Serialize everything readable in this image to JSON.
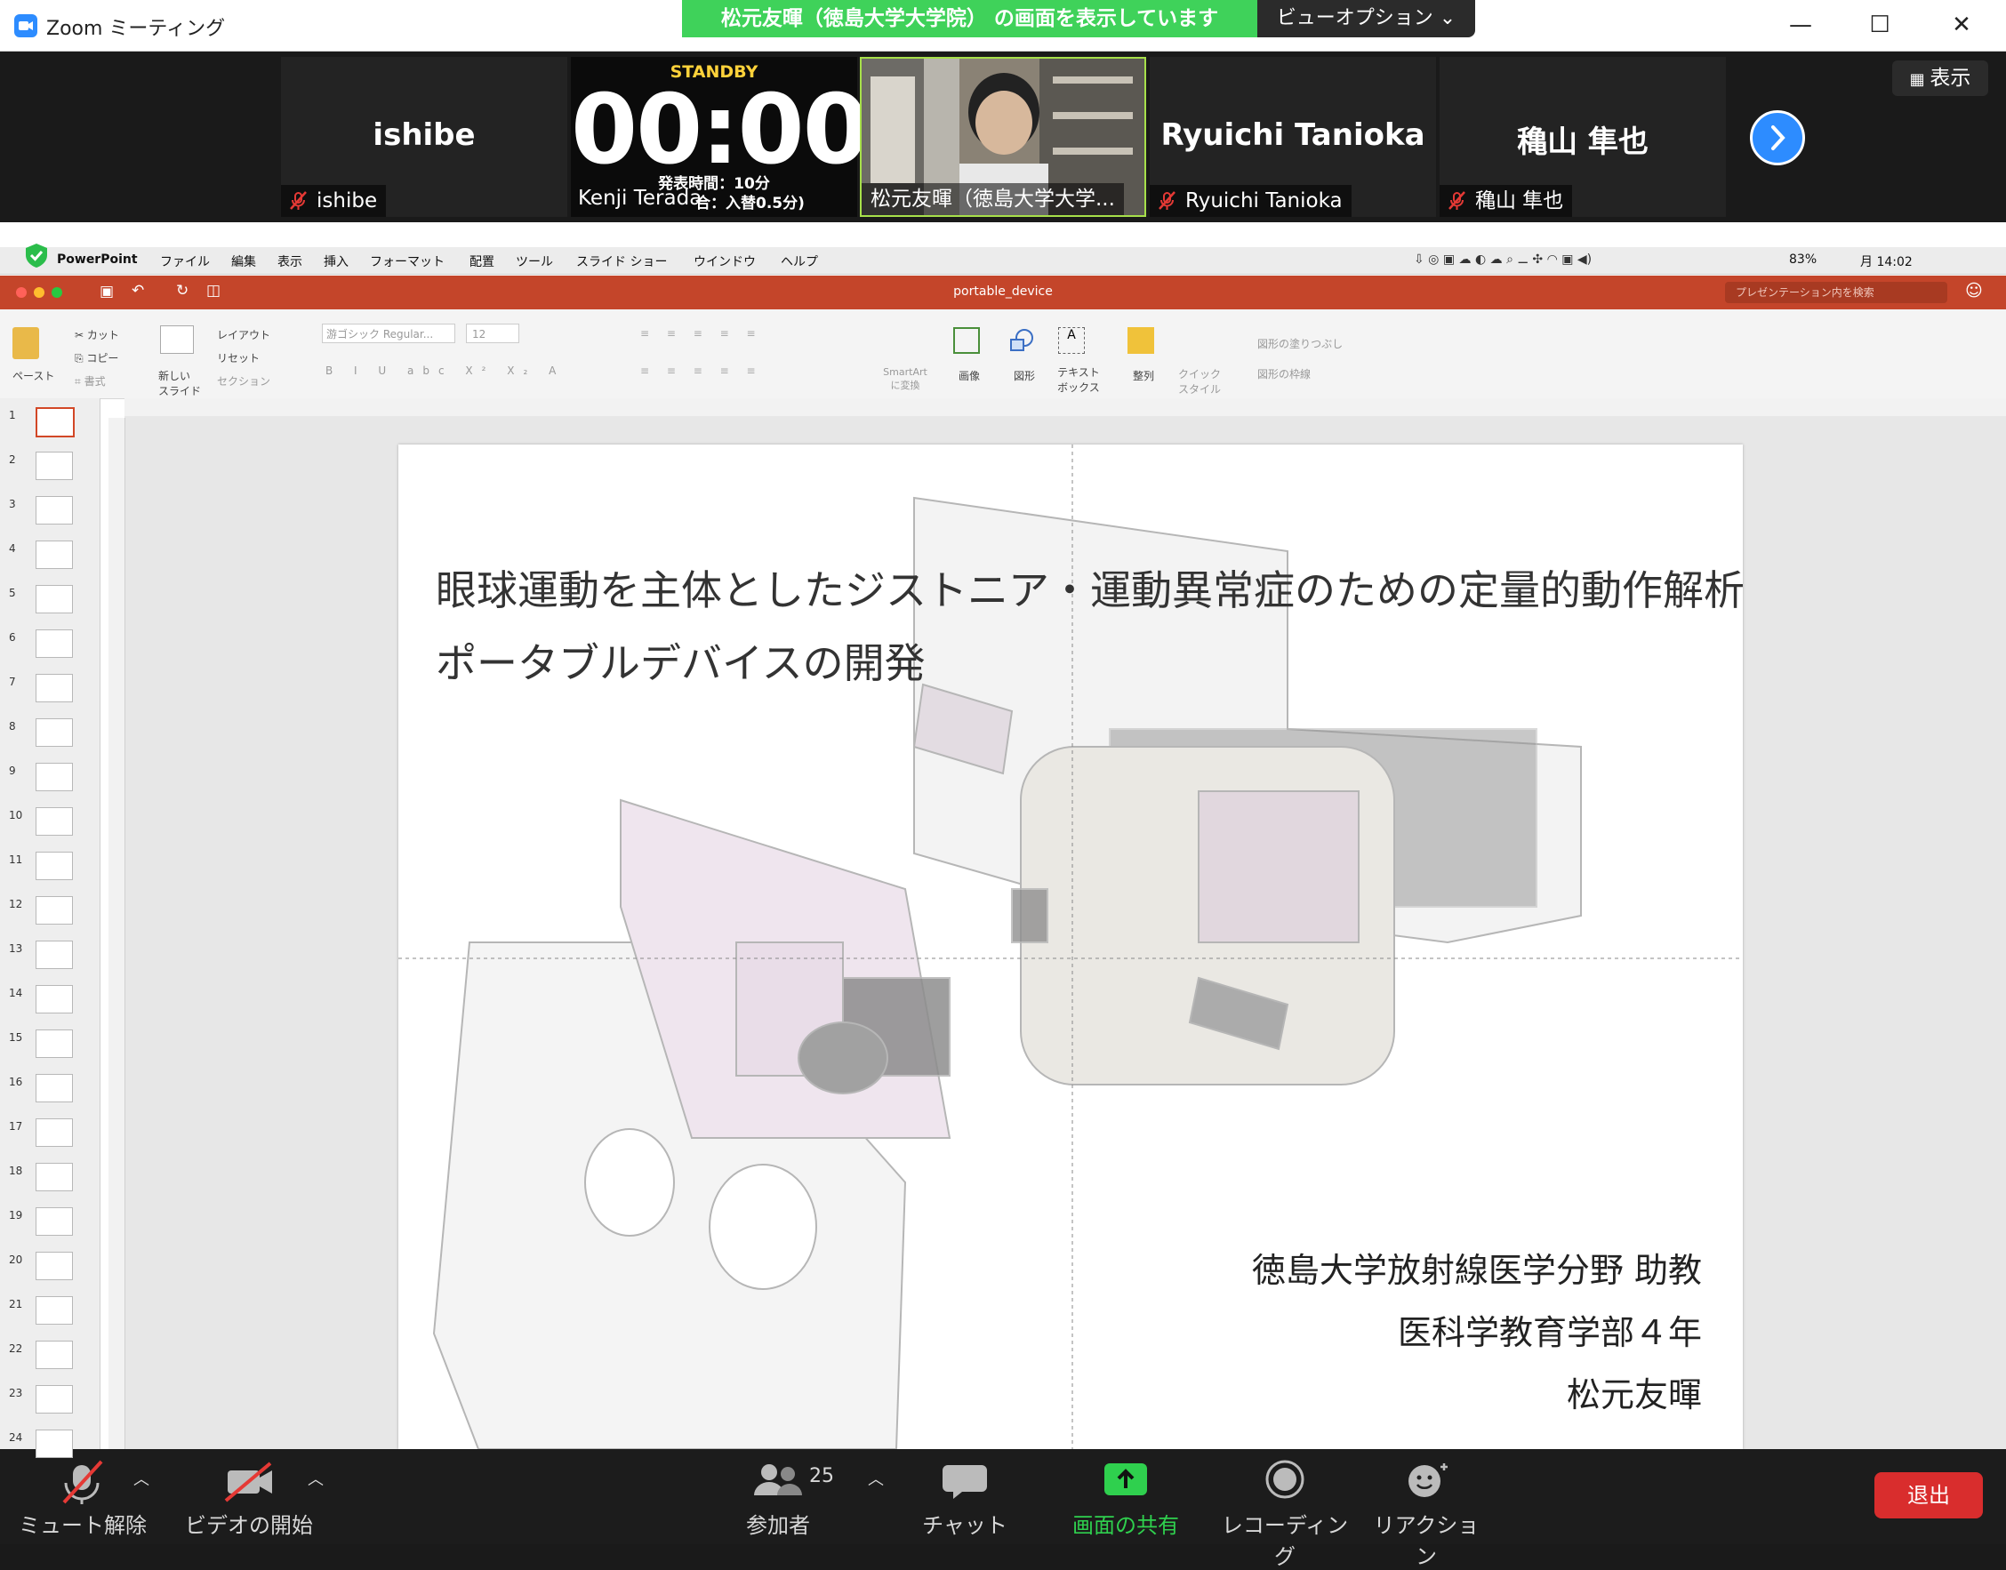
{
  "window": {
    "title": "Zoom ミーティング",
    "share_banner": "松元友暉（徳島大学大学院） の画面を表示しています",
    "view_options": "ビューオプション ⌄"
  },
  "video_strip": {
    "show_button": "表示",
    "participants": [
      {
        "display": "ishibe",
        "label": "ishibe"
      },
      {
        "label": "Kenji Terada"
      },
      {
        "label": "松元友暉（徳島大学大学..."
      },
      {
        "display": "Ryuichi Tanioka",
        "label": "Ryuichi Tanioka"
      },
      {
        "display": "穐山 隼也",
        "label": "穐山 隼也"
      }
    ],
    "timer": {
      "status": "STANDBY",
      "value": "00:00",
      "line1": "発表時間：10分",
      "line2": "合：入替0.5分)"
    }
  },
  "mac_menubar": {
    "app": "PowerPoint",
    "items": [
      "ファイル",
      "編集",
      "表示",
      "挿入",
      "フォーマット",
      "配置",
      "ツール",
      "スライド ショー",
      "ウインドウ",
      "ヘルプ"
    ],
    "battery": "83%",
    "clock": "月 14:02"
  },
  "ppt": {
    "doc_title": "portable_device",
    "search_placeholder": "プレゼンテーション内を検索",
    "ribbon": {
      "paste": "ペースト",
      "cut": "カット",
      "copy": "コピー",
      "format": "書式",
      "new_slide": "新しい スライド",
      "layout": "レイアウト",
      "reset": "リセット",
      "section": "セクション",
      "font": "游ゴシック Regular...",
      "size": "12",
      "smartart": "SmartArt に変換",
      "image": "画像",
      "shapes": "図形",
      "textbox": "テキスト ボックス",
      "arrange": "整列",
      "quick_style": "クイック スタイル",
      "shape_fill": "図形の塗りつぶし",
      "shape_outline": "図形の枠線"
    },
    "thumbnails": [
      "1",
      "2",
      "3",
      "4",
      "5",
      "6",
      "7",
      "8",
      "9",
      "10",
      "11",
      "12",
      "13",
      "14",
      "15",
      "16",
      "17",
      "18",
      "19",
      "20",
      "21",
      "22",
      "23",
      "24"
    ],
    "slide": {
      "title_line1": "眼球運動を主体としたジストニア・運動異常症のための定量的動作解析",
      "title_line2": "ポータブルデバイスの開発",
      "affiliation": "徳島大学放射線医学分野 助教",
      "department": "医科学教育学部４年",
      "author": "松元友暉"
    }
  },
  "toolbar": {
    "unmute": "ミュート解除",
    "start_video": "ビデオの開始",
    "participants": "参加者",
    "participant_count": "25",
    "chat": "チャット",
    "share_screen": "画面の共有",
    "recording": "レコーディング",
    "reactions": "リアクション",
    "leave": "退出"
  },
  "colors": {
    "share_green": "#3fd25a",
    "zoom_blue": "#2d8cff",
    "ppt_red": "#c4452a",
    "leave_red": "#d92d2d"
  }
}
